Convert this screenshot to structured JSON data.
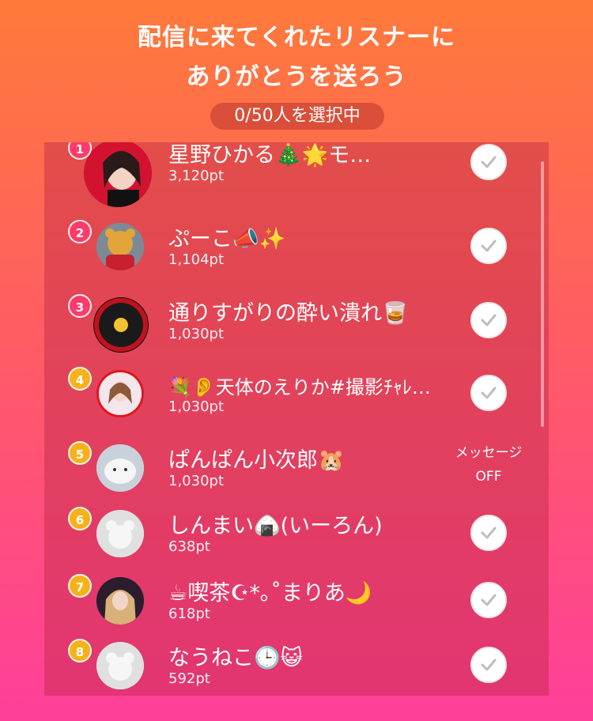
{
  "header": {
    "title_line1": "配信に来てくれたリスナーに",
    "title_line2": "ありがとうを送ろう",
    "selected_count": "0/50人を選択中"
  },
  "listeners": [
    {
      "rank": "1",
      "name": "星野ひかる🎄🌟モ…",
      "points": "3,120pt",
      "action": "check",
      "rank_color": "#ff3b6b"
    },
    {
      "rank": "2",
      "name": "ぷーこ📣✨",
      "points": "1,104pt",
      "action": "check",
      "rank_color": "#ff3b6b"
    },
    {
      "rank": "3",
      "name": "通りすがりの酔い潰れ🥃",
      "points": "1,030pt",
      "action": "check",
      "rank_color": "#ff3b6b"
    },
    {
      "rank": "4",
      "name": "💐👂天体のえりか#撮影ﾁｬﾚ…",
      "points": "1,030pt",
      "action": "check",
      "rank_color": "#f7b21a"
    },
    {
      "rank": "5",
      "name": "ぱんぱん小次郎🐹",
      "points": "1,030pt",
      "action": "off",
      "off_label_line1": "メッセージ",
      "off_label_line2": "OFF",
      "rank_color": "#f7b21a"
    },
    {
      "rank": "6",
      "name": "しんまい🍙(いーろん)",
      "points": "638pt",
      "action": "check",
      "rank_color": "#f7b21a"
    },
    {
      "rank": "7",
      "name": "☕喫茶☪︎*｡˚まりあ🌙",
      "points": "618pt",
      "action": "check",
      "rank_color": "#f7b21a"
    },
    {
      "rank": "8",
      "name": "なうねこ🕒😺",
      "points": "592pt",
      "action": "check",
      "rank_color": "#f7b21a"
    }
  ]
}
